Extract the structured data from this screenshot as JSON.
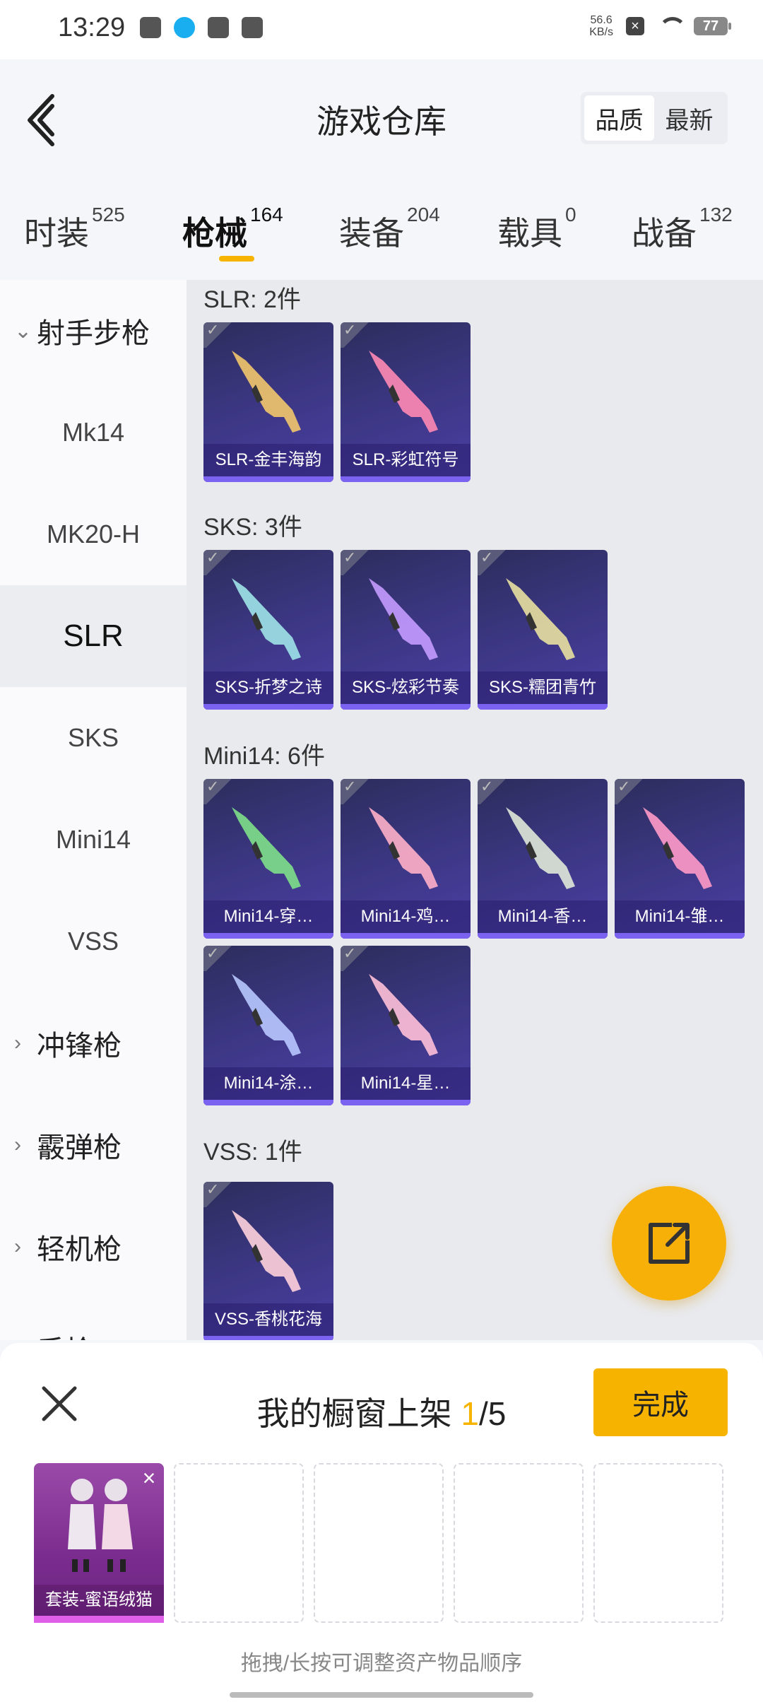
{
  "status": {
    "time": "13:29",
    "net_speed_value": "56.6",
    "net_speed_unit": "KB/s",
    "battery": "77"
  },
  "header": {
    "title": "游戏仓库",
    "sort": [
      "品质",
      "最新"
    ]
  },
  "tabs": [
    {
      "label": "时装",
      "count": "525"
    },
    {
      "label": "枪械",
      "count": "164"
    },
    {
      "label": "装备",
      "count": "204"
    },
    {
      "label": "载具",
      "count": "0"
    },
    {
      "label": "战备",
      "count": "132"
    }
  ],
  "sidebar": {
    "group_open": "射手步枪",
    "items": [
      "Mk14",
      "MK20-H",
      "SLR",
      "SKS",
      "Mini14",
      "VSS"
    ],
    "groups": [
      "冲锋枪",
      "霰弹枪",
      "轻机枪",
      "手枪"
    ]
  },
  "sections": [
    {
      "title": "SLR: 2件",
      "items": [
        "SLR-金丰海韵",
        "SLR-彩虹符号"
      ]
    },
    {
      "title": "SKS: 3件",
      "items": [
        "SKS-折梦之诗",
        "SKS-炫彩节奏",
        "SKS-糯团青竹"
      ]
    },
    {
      "title": "Mini14: 6件",
      "items": [
        "Mini14-穿…",
        "Mini14-鸡…",
        "Mini14-香…",
        "Mini14-雏…",
        "Mini14-涂…",
        "Mini14-星…"
      ]
    },
    {
      "title": "VSS: 1件",
      "items": [
        "VSS-香桃花海"
      ]
    }
  ],
  "sheet": {
    "title_prefix": "我的橱窗上架 ",
    "current": "1",
    "total": "/5",
    "done": "完成",
    "slot_item": "套装-蜜语绒猫",
    "hint": "拖拽/长按可调整资产物品顺序"
  },
  "colors": {
    "accent": "#f6b400",
    "card": "#3b3680",
    "slot": "#7a2c8e"
  }
}
